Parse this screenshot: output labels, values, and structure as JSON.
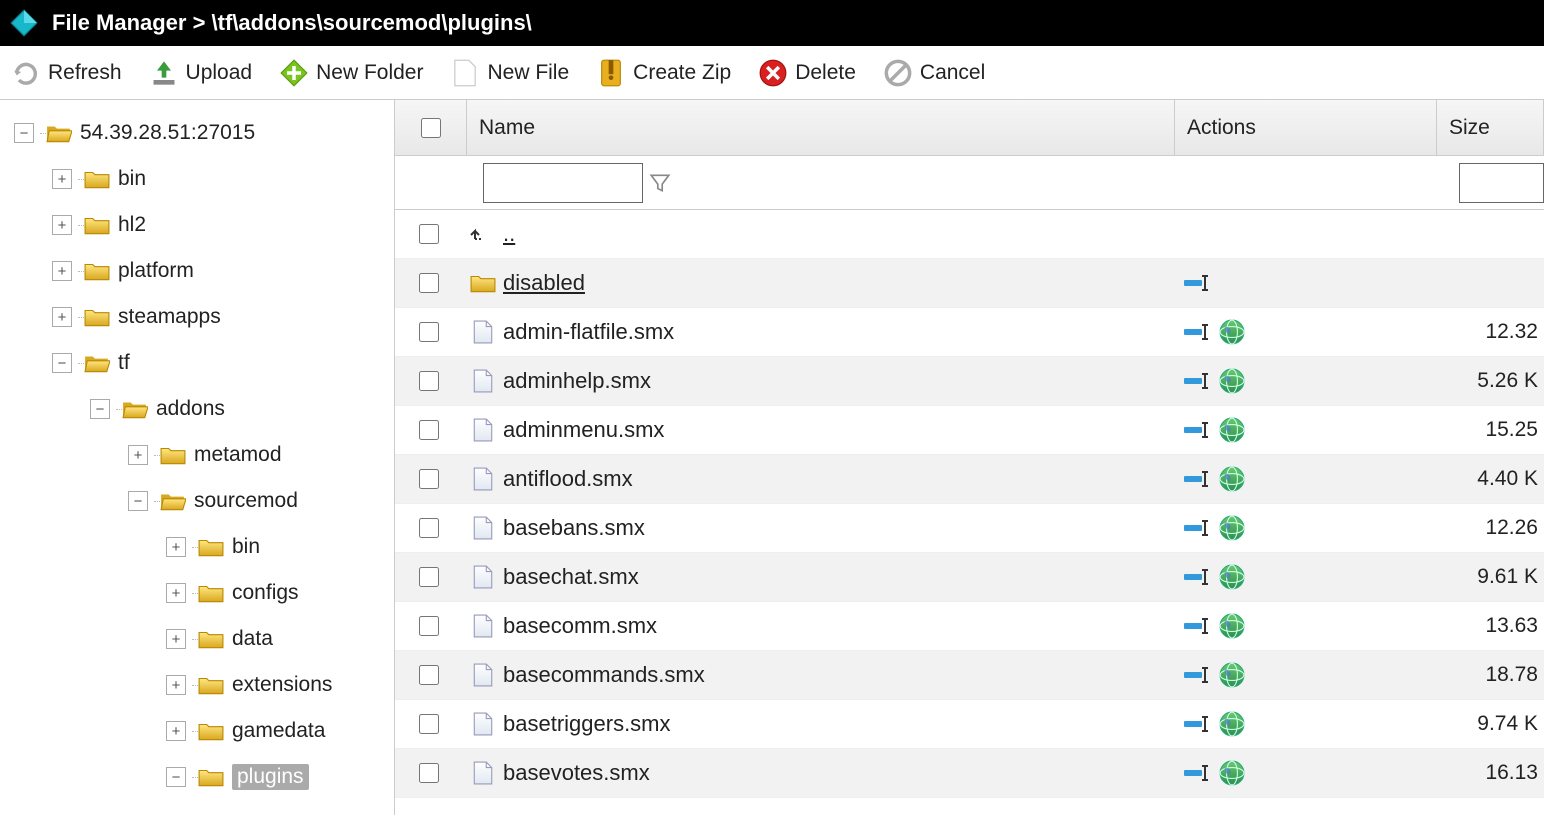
{
  "header": {
    "title": "File Manager > \\tf\\addons\\sourcemod\\plugins\\"
  },
  "toolbar": {
    "refresh": "Refresh",
    "upload": "Upload",
    "new_folder": "New Folder",
    "new_file": "New File",
    "create_zip": "Create Zip",
    "delete": "Delete",
    "cancel": "Cancel"
  },
  "tree": {
    "root": "54.39.28.51:27015",
    "bin": "bin",
    "hl2": "hl2",
    "platform": "platform",
    "steamapps": "steamapps",
    "tf": "tf",
    "addons": "addons",
    "metamod": "metamod",
    "sourcemod": "sourcemod",
    "sm_bin": "bin",
    "configs": "configs",
    "data": "data",
    "extensions": "extensions",
    "gamedata": "gamedata",
    "plugins": "plugins"
  },
  "grid": {
    "col_name": "Name",
    "col_actions": "Actions",
    "col_size": "Size",
    "parent": "..",
    "rows": [
      {
        "type": "folder",
        "name": "disabled",
        "size": ""
      },
      {
        "type": "file",
        "name": "admin-flatfile.smx",
        "size": "12.32"
      },
      {
        "type": "file",
        "name": "adminhelp.smx",
        "size": "5.26 K"
      },
      {
        "type": "file",
        "name": "adminmenu.smx",
        "size": "15.25"
      },
      {
        "type": "file",
        "name": "antiflood.smx",
        "size": "4.40 K"
      },
      {
        "type": "file",
        "name": "basebans.smx",
        "size": "12.26"
      },
      {
        "type": "file",
        "name": "basechat.smx",
        "size": "9.61 K"
      },
      {
        "type": "file",
        "name": "basecomm.smx",
        "size": "13.63"
      },
      {
        "type": "file",
        "name": "basecommands.smx",
        "size": "18.78"
      },
      {
        "type": "file",
        "name": "basetriggers.smx",
        "size": "9.74 K"
      },
      {
        "type": "file",
        "name": "basevotes.smx",
        "size": "16.13"
      }
    ]
  }
}
